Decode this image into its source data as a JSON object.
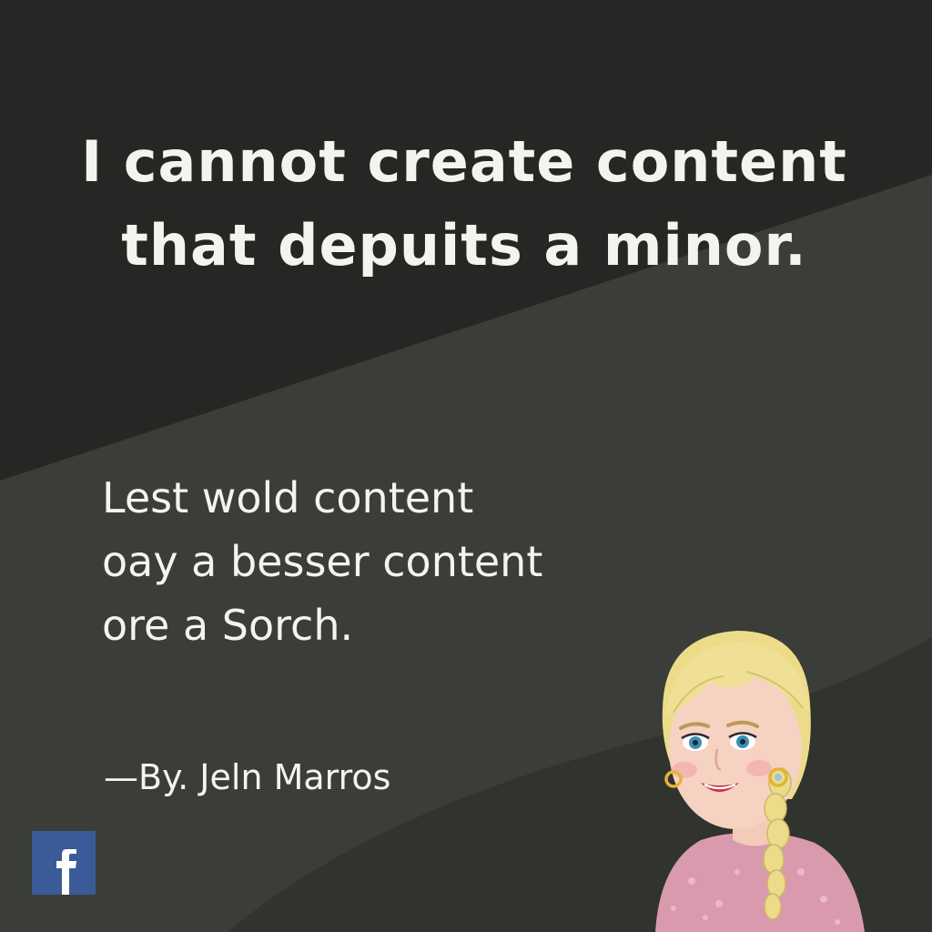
{
  "headline": "I cannot create content that depuits a minor.",
  "quote": {
    "lines": [
      "Lest wold content",
      "oay a besser content",
      "ore a Sorch."
    ]
  },
  "byline": "—By. Jeln Marros",
  "logo": {
    "icon": "facebook-icon",
    "text": "f"
  },
  "colors": {
    "background_dark": "#262724",
    "background_band": "#3a3d38",
    "text": "#f4f4ef",
    "facebook_blue": "#3b5b98"
  }
}
